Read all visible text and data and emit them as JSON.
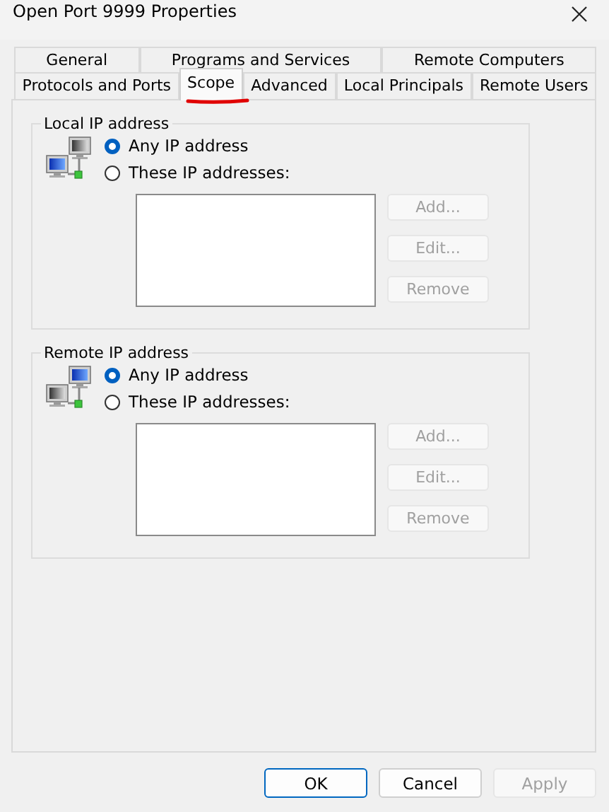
{
  "window": {
    "title": "Open Port 9999 Properties"
  },
  "tab_rows": [
    [
      {
        "label": "General",
        "selected": false
      },
      {
        "label": "Programs and Services",
        "selected": false
      },
      {
        "label": "Remote Computers",
        "selected": false
      }
    ],
    [
      {
        "label": "Protocols and Ports",
        "selected": false
      },
      {
        "label": "Scope",
        "selected": true
      },
      {
        "label": "Advanced",
        "selected": false
      },
      {
        "label": "Local Principals",
        "selected": false
      },
      {
        "label": "Remote Users",
        "selected": false
      }
    ]
  ],
  "groups": [
    {
      "title": "Local IP address",
      "kind": "local",
      "options": [
        {
          "label": "Any IP address",
          "selected": true
        },
        {
          "label": "These IP addresses:",
          "selected": false
        }
      ],
      "buttons": [
        {
          "label": "Add...",
          "disabled": true
        },
        {
          "label": "Edit...",
          "disabled": true
        },
        {
          "label": "Remove",
          "disabled": true
        }
      ]
    },
    {
      "title": "Remote IP address",
      "kind": "remote",
      "options": [
        {
          "label": "Any IP address",
          "selected": true
        },
        {
          "label": "These IP addresses:",
          "selected": false
        }
      ],
      "buttons": [
        {
          "label": "Add...",
          "disabled": true
        },
        {
          "label": "Edit...",
          "disabled": true
        },
        {
          "label": "Remove",
          "disabled": true
        }
      ]
    }
  ],
  "buttons": [
    {
      "label": "OK",
      "default": true,
      "disabled": false
    },
    {
      "label": "Cancel",
      "default": false,
      "disabled": false
    },
    {
      "label": "Apply",
      "default": false,
      "disabled": true
    }
  ]
}
